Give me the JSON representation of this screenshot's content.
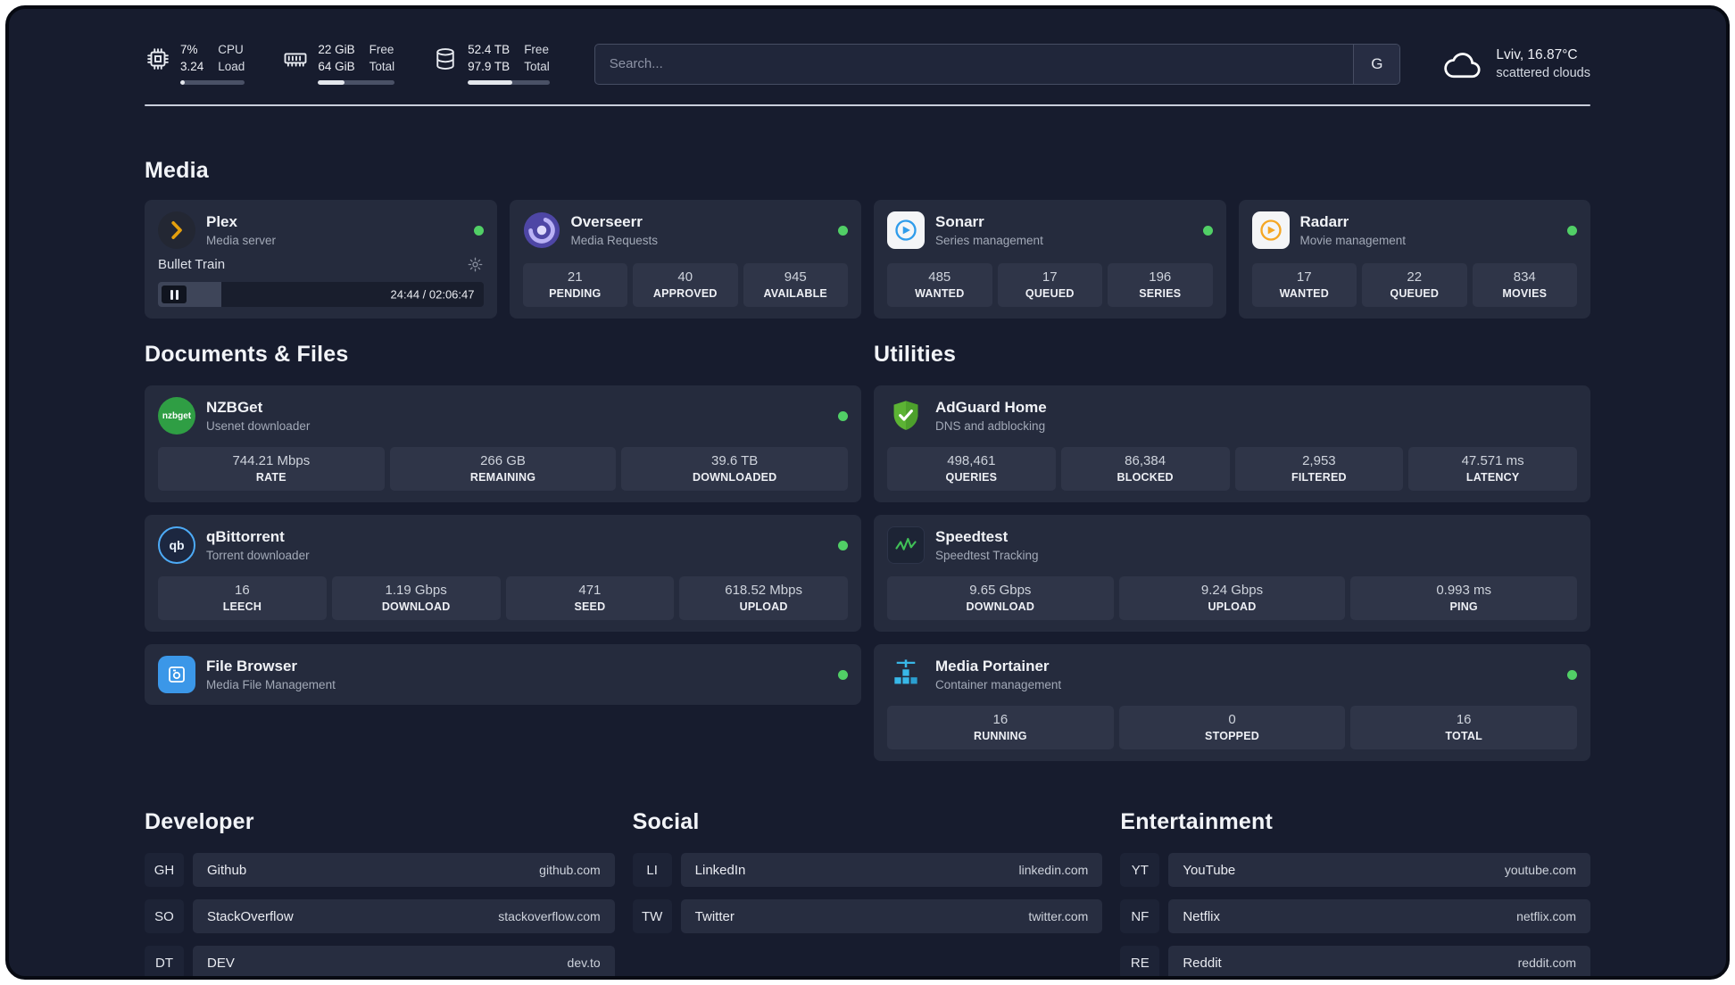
{
  "topbar": {
    "metrics": [
      {
        "name": "cpu",
        "value_top": "7%",
        "value_bottom": "3.24",
        "label_top": "CPU",
        "label_bottom": "Load",
        "percent": 7
      },
      {
        "name": "ram",
        "value_top": "22 GiB",
        "value_bottom": "64 GiB",
        "label_top": "Free",
        "label_bottom": "Total",
        "percent": 34
      },
      {
        "name": "disk",
        "value_top": "52.4 TB",
        "value_bottom": "97.9 TB",
        "label_top": "Free",
        "label_bottom": "Total",
        "percent": 54
      }
    ],
    "search": {
      "placeholder": "Search...",
      "button_label": "G"
    },
    "weather": {
      "location": "Lviv, 16.87°C",
      "condition": "scattered clouds"
    }
  },
  "sections": {
    "media": "Media",
    "documents": "Documents & Files",
    "utilities": "Utilities",
    "developer": "Developer",
    "social": "Social",
    "entertainment": "Entertainment"
  },
  "apps": {
    "plex": {
      "title": "Plex",
      "subtitle": "Media server",
      "now_playing": "Bullet Train",
      "time": "24:44 / 02:06:47",
      "progress_percent": 19.5
    },
    "overseerr": {
      "title": "Overseerr",
      "subtitle": "Media Requests",
      "stats": [
        {
          "value": "21",
          "label": "PENDING"
        },
        {
          "value": "40",
          "label": "APPROVED"
        },
        {
          "value": "945",
          "label": "AVAILABLE"
        }
      ]
    },
    "sonarr": {
      "title": "Sonarr",
      "subtitle": "Series management",
      "stats": [
        {
          "value": "485",
          "label": "WANTED"
        },
        {
          "value": "17",
          "label": "QUEUED"
        },
        {
          "value": "196",
          "label": "SERIES"
        }
      ]
    },
    "radarr": {
      "title": "Radarr",
      "subtitle": "Movie management",
      "stats": [
        {
          "value": "17",
          "label": "WANTED"
        },
        {
          "value": "22",
          "label": "QUEUED"
        },
        {
          "value": "834",
          "label": "MOVIES"
        }
      ]
    },
    "nzbget": {
      "title": "NZBGet",
      "subtitle": "Usenet downloader",
      "logo_text": "nzbget",
      "stats": [
        {
          "value": "744.21 Mbps",
          "label": "RATE"
        },
        {
          "value": "266 GB",
          "label": "REMAINING"
        },
        {
          "value": "39.6 TB",
          "label": "DOWNLOADED"
        }
      ]
    },
    "qbittorrent": {
      "title": "qBittorrent",
      "subtitle": "Torrent downloader",
      "logo_text": "qb",
      "stats": [
        {
          "value": "16",
          "label": "LEECH"
        },
        {
          "value": "1.19 Gbps",
          "label": "DOWNLOAD"
        },
        {
          "value": "471",
          "label": "SEED"
        },
        {
          "value": "618.52 Mbps",
          "label": "UPLOAD"
        }
      ]
    },
    "filebrowser": {
      "title": "File Browser",
      "subtitle": "Media File Management"
    },
    "adguard": {
      "title": "AdGuard Home",
      "subtitle": "DNS and adblocking",
      "stats": [
        {
          "value": "498,461",
          "label": "QUERIES"
        },
        {
          "value": "86,384",
          "label": "BLOCKED"
        },
        {
          "value": "2,953",
          "label": "FILTERED"
        },
        {
          "value": "47.571 ms",
          "label": "LATENCY"
        }
      ]
    },
    "speedtest": {
      "title": "Speedtest",
      "subtitle": "Speedtest Tracking",
      "stats": [
        {
          "value": "9.65 Gbps",
          "label": "DOWNLOAD"
        },
        {
          "value": "9.24 Gbps",
          "label": "UPLOAD"
        },
        {
          "value": "0.993 ms",
          "label": "PING"
        }
      ]
    },
    "portainer": {
      "title": "Media Portainer",
      "subtitle": "Container management",
      "stats": [
        {
          "value": "16",
          "label": "RUNNING"
        },
        {
          "value": "0",
          "label": "STOPPED"
        },
        {
          "value": "16",
          "label": "TOTAL"
        }
      ]
    }
  },
  "bookmarks": {
    "developer": [
      {
        "abbr": "GH",
        "name": "Github",
        "url": "github.com"
      },
      {
        "abbr": "SO",
        "name": "StackOverflow",
        "url": "stackoverflow.com"
      },
      {
        "abbr": "DT",
        "name": "DEV",
        "url": "dev.to"
      }
    ],
    "social": [
      {
        "abbr": "LI",
        "name": "LinkedIn",
        "url": "linkedin.com"
      },
      {
        "abbr": "TW",
        "name": "Twitter",
        "url": "twitter.com"
      }
    ],
    "entertainment": [
      {
        "abbr": "YT",
        "name": "YouTube",
        "url": "youtube.com"
      },
      {
        "abbr": "NF",
        "name": "Netflix",
        "url": "netflix.com"
      },
      {
        "abbr": "RE",
        "name": "Reddit",
        "url": "reddit.com"
      }
    ]
  },
  "icons": {
    "cpu": "cpu-chip-icon",
    "ram": "memory-module-icon",
    "disk": "storage-database-icon",
    "weather": "cloud-icon",
    "settings": "gear-icon",
    "pause": "pause-icon"
  },
  "colors": {
    "status_online": "#51cf66",
    "plex_accent": "#e5a00d",
    "overseerr_purple": "#4e46a5",
    "sonarr_blue": "#2f9ceb",
    "radarr_amber": "#f5a623",
    "nzbget_green": "#2f9e44",
    "qbittorrent_blue": "#4dabf7",
    "filebrowser_blue": "#3b97e8",
    "adguard_green": "#5cb334",
    "speedtest_green": "#40c057",
    "portainer_blue": "#38b8e8"
  }
}
